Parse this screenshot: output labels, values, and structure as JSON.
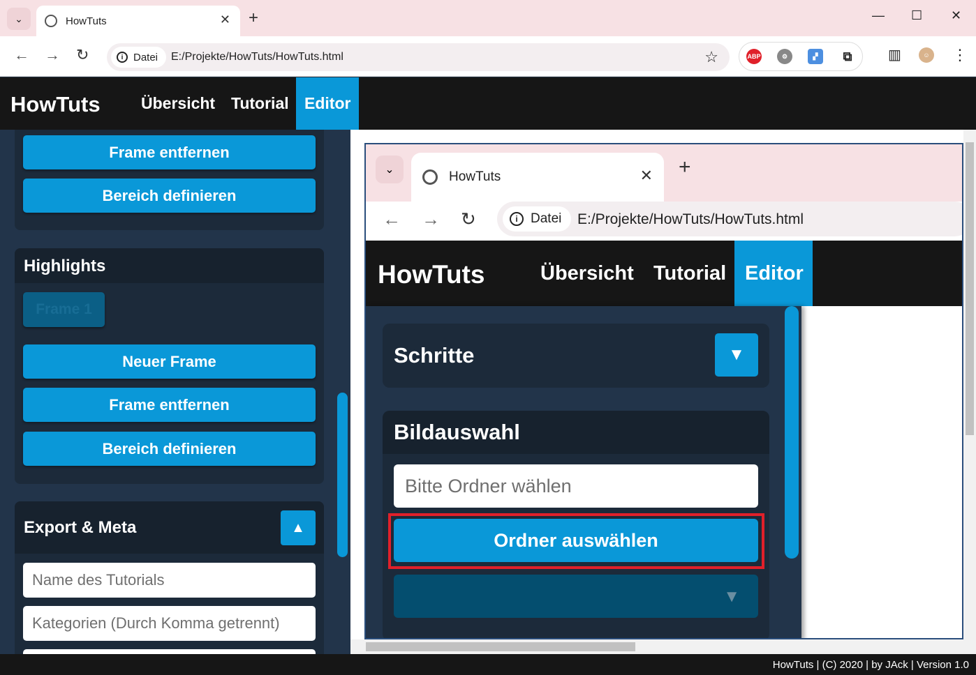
{
  "browser": {
    "tab_title": "HowTuts",
    "new_tab": "+",
    "datei_label": "Datei",
    "url": "E:/Projekte/HowTuts/HowTuts.html",
    "ext_abp": "ABP"
  },
  "app": {
    "brand": "HowTuts",
    "nav": [
      "Übersicht",
      "Tutorial",
      "Editor"
    ],
    "active_nav": "Editor"
  },
  "sidebar": {
    "top_buttons": [
      "Frame entfernen",
      "Bereich definieren"
    ],
    "highlights": {
      "title": "Highlights",
      "frame_chip": "Frame 1",
      "buttons": [
        "Neuer Frame",
        "Frame entfernen",
        "Bereich definieren"
      ]
    },
    "export": {
      "title": "Export & Meta",
      "name_placeholder": "Name des Tutorials",
      "categories_placeholder": "Kategorien (Durch Komma getrennt)"
    }
  },
  "preview": {
    "tab_title": "HowTuts",
    "new_tab": "+",
    "datei_label": "Datei",
    "url": "E:/Projekte/HowTuts/HowTuts.html",
    "brand": "HowTuts",
    "nav": [
      "Übersicht",
      "Tutorial",
      "Editor"
    ],
    "steps_title": "Schritte",
    "image_title": "Bildauswahl",
    "folder_placeholder": "Bitte Ordner wählen",
    "folder_button": "Ordner auswählen"
  },
  "footer": {
    "text": "HowTuts | (C) 2020 | by JAck | Version 1.0"
  },
  "colors": {
    "accent": "#0a98d8",
    "header_bg": "#161616",
    "sidebar_bg": "#22344a",
    "highlight_border": "#e0202a"
  }
}
